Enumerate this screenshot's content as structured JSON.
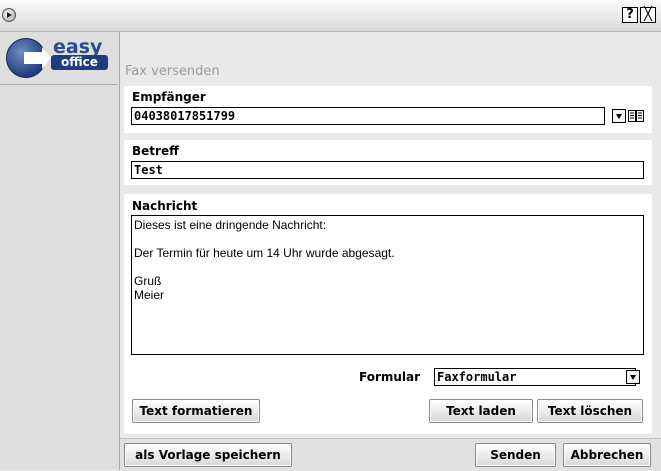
{
  "window": {
    "help_label": "?",
    "close_label": "╳"
  },
  "logo": {
    "top": "easy",
    "bottom": "office"
  },
  "section_title": "Fax versenden",
  "recipient": {
    "label": "Empfänger",
    "value": "04038017851799"
  },
  "subject": {
    "label": "Betreff",
    "value": "Test"
  },
  "message": {
    "label": "Nachricht",
    "text": "Dieses ist eine dringende Nachricht:\n\nDer Termin für heute um 14 Uhr wurde abgesagt.\n\nGruß\nMeier"
  },
  "form": {
    "label": "Formular",
    "selected": "Faxformular"
  },
  "buttons": {
    "format_text": "Text formatieren",
    "load_text": "Text laden",
    "delete_text": "Text löschen",
    "save_template": "als Vorlage speichern",
    "send": "Senden",
    "cancel": "Abbrechen"
  },
  "icons": {
    "app": "app-icon",
    "addressbook": "address-book-icon"
  }
}
